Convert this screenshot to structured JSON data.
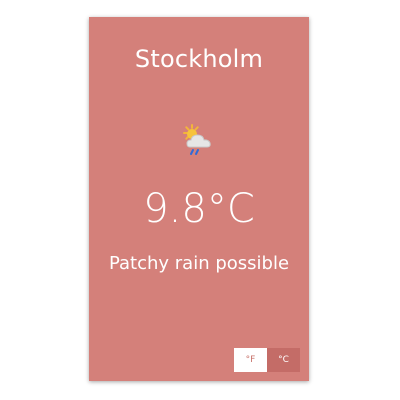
{
  "weather": {
    "city": "Stockholm",
    "icon": "partly-cloudy-rain-icon",
    "temperature": "9.8°C",
    "condition": "Patchy rain possible"
  },
  "units": {
    "fahrenheit_label": "°F",
    "celsius_label": "°C",
    "selected": "°C"
  },
  "colors": {
    "card_background": "#d4807a",
    "active_unit_background": "#c46c67",
    "inactive_unit_background": "#ffffff"
  }
}
